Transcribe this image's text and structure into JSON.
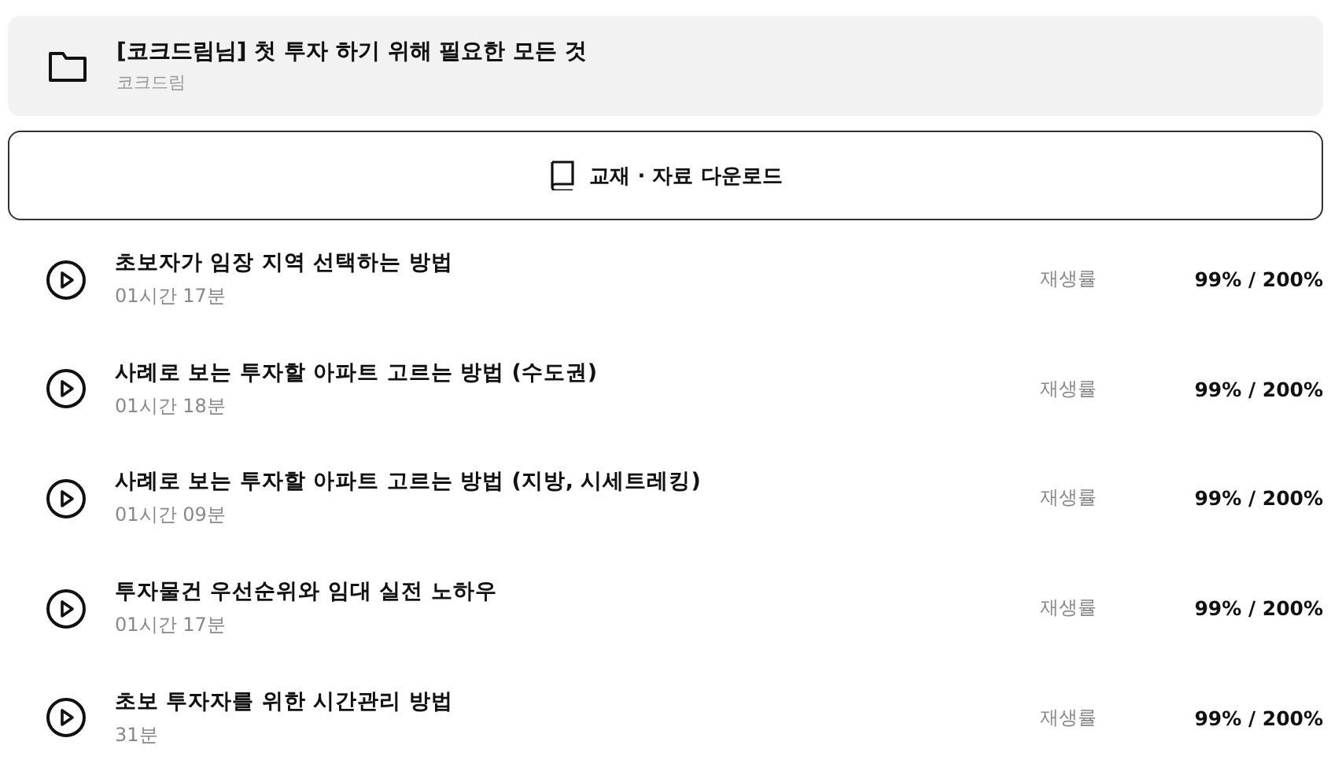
{
  "course": {
    "title": "[코크드림님] 첫 투자 하기 위해 필요한 모든 것",
    "author": "코크드림"
  },
  "download_button": {
    "label": "교재 · 자료 다운로드"
  },
  "lessons": [
    {
      "title": "초보자가 임장 지역 선택하는 방법",
      "duration": "01시간 17분",
      "rate_label": "재생률",
      "rate": "99% / 200%"
    },
    {
      "title": "사례로 보는 투자할 아파트 고르는 방법 (수도권)",
      "duration": "01시간 18분",
      "rate_label": "재생률",
      "rate": "99% / 200%"
    },
    {
      "title": "사례로 보는 투자할 아파트 고르는 방법 (지방, 시세트레킹)",
      "duration": "01시간 09분",
      "rate_label": "재생률",
      "rate": "99% / 200%"
    },
    {
      "title": "투자물건 우선순위와 임대 실전 노하우",
      "duration": "01시간 17분",
      "rate_label": "재생률",
      "rate": "99% / 200%"
    },
    {
      "title": "초보 투자자를 위한 시간관리 방법",
      "duration": "31분",
      "rate_label": "재생률",
      "rate": "99% / 200%"
    }
  ]
}
